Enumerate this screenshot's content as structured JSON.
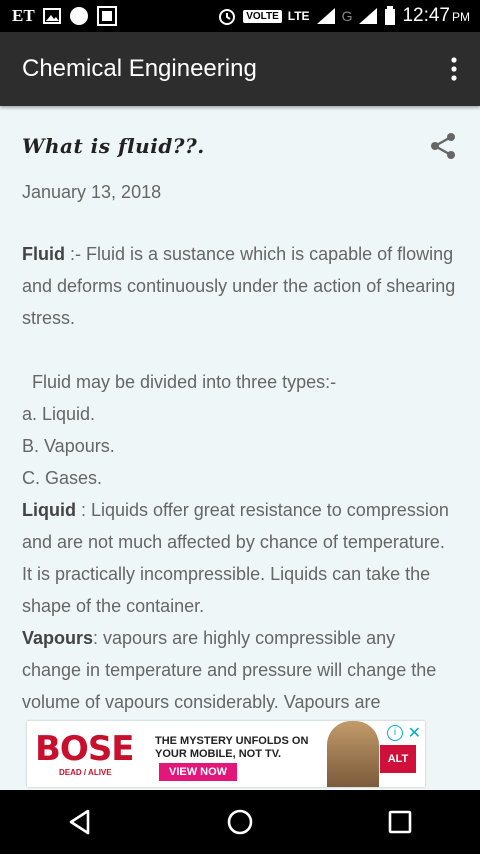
{
  "status_bar": {
    "carrier": "ET",
    "volte": "VOLTE",
    "network": "LTE",
    "network2": "G",
    "time": "12:47",
    "ampm": "PM"
  },
  "app_bar": {
    "title": "Chemical Engineering"
  },
  "post": {
    "title": "What is fluid??.",
    "date": "January 13, 2018",
    "fluid_term": "Fluid",
    "fluid_def": " :- Fluid is a sustance which is capable of flowing and deforms continuously under the action of shearing stress.",
    "types_intro": "Fluid may be divided into three types:-",
    "types": [
      "a. Liquid.",
      "B. Vapours.",
      "C. Gases."
    ],
    "liquid_term": "Liquid",
    "liquid_def": " : Liquids offer great resistance to compression and are not much affected by chance of temperature. It is practically incompressible. Liquids can take the shape of the container.",
    "vapour_term": "Vapours",
    "vapour_def": ": vapours are highly compressible  any change in temperature and pressure will change the volume of vapours considerably. Vapours are"
  },
  "ad": {
    "logo": "BOSE",
    "logo_sub": "DEAD / ALIVE",
    "headline1": "THE MYSTERY UNFOLDS ON",
    "headline2": "YOUR MOBILE, NOT TV.",
    "cta": "VIEW NOW",
    "badge": "ALT",
    "info": "i",
    "close": "✕"
  },
  "colors": {
    "app_bar": "#2d2d2d",
    "background": "#eef6f8",
    "body_text": "#666666"
  }
}
